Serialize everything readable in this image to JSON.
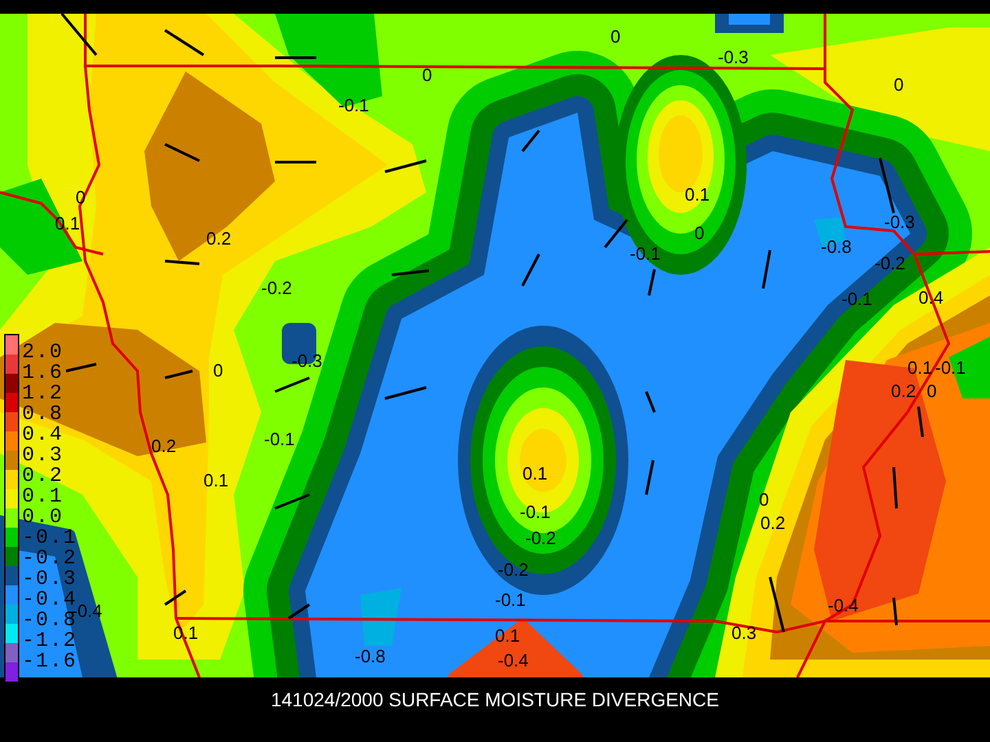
{
  "map": {
    "contour_labels": [
      "0",
      "0",
      "-0.3",
      "0",
      "-0.1",
      "0",
      "0.1",
      "0.1",
      "-0.3",
      "0.2",
      "0",
      "-0.1",
      "-0.8",
      "-0.2",
      "-0.2",
      "-0.1",
      "0.4",
      "-0.3",
      "0",
      "0.1",
      "-0.1",
      "0.2",
      "0",
      "-0.1",
      "0.2",
      "0.1",
      "0.1",
      "-0.1",
      "-0.2",
      "-0.2",
      "-0.1",
      "0.1",
      "-0.4",
      "0",
      "0.2",
      "-0.4",
      "0.1",
      "-0.4",
      "0.3",
      "-0.8"
    ]
  },
  "legend": {
    "swatches": [
      {
        "color": "#ff7070"
      },
      {
        "color": "#e83838"
      },
      {
        "color": "#900000"
      },
      {
        "color": "#d80000"
      },
      {
        "color": "#f04810"
      },
      {
        "color": "#ff8000"
      },
      {
        "color": "#cc8000"
      },
      {
        "color": "#ffd700"
      },
      {
        "color": "#f0f000"
      },
      {
        "color": "#80ff00"
      },
      {
        "color": "#00cc00"
      },
      {
        "color": "#008000"
      },
      {
        "color": "#105090"
      },
      {
        "color": "#2090ff"
      },
      {
        "color": "#00b0e0"
      },
      {
        "color": "#00e8f0"
      },
      {
        "color": "#8060c0"
      },
      {
        "color": "#8020e0"
      }
    ],
    "labels": [
      "2.0",
      "1.6",
      "1.2",
      "0.8",
      "0.4",
      "0.3",
      "0.2",
      "0.1",
      "0.0",
      "-0.1",
      "-0.2",
      "-0.3",
      "-0.4",
      "-0.8",
      "-1.2",
      "-1.6"
    ]
  },
  "title": "141024/2000 SURFACE MOISTURE DIVERGENCE"
}
